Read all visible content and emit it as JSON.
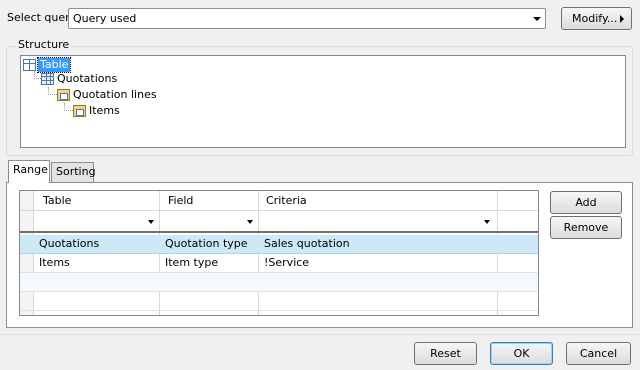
{
  "select_query": {
    "label": "Select query:",
    "value": "Query used",
    "modify_label": "Modify..."
  },
  "structure": {
    "legend": "Structure",
    "nodes": [
      {
        "label": "Table",
        "icon": "table-icon",
        "selected": true
      },
      {
        "label": "Quotations",
        "icon": "grid-table-icon"
      },
      {
        "label": "Quotation lines",
        "icon": "linked-table-icon"
      },
      {
        "label": "Items",
        "icon": "linked-table-icon"
      }
    ]
  },
  "tabs": [
    {
      "label": "Range",
      "active": true
    },
    {
      "label": "Sorting",
      "active": false
    }
  ],
  "range_grid": {
    "columns": [
      "Table",
      "Field",
      "Criteria"
    ],
    "rows": [
      {
        "table": "Quotations",
        "field": "Quotation type",
        "criteria": "Sales quotation",
        "selected": true
      },
      {
        "table": "Items",
        "field": "Item type",
        "criteria": "!Service",
        "selected": false
      }
    ]
  },
  "side_buttons": {
    "add": "Add",
    "remove": "Remove"
  },
  "footer": {
    "reset": "Reset",
    "ok": "OK",
    "cancel": "Cancel"
  },
  "colors": {
    "selection": "#3399ff",
    "row_highlight": "#cde8f6"
  }
}
